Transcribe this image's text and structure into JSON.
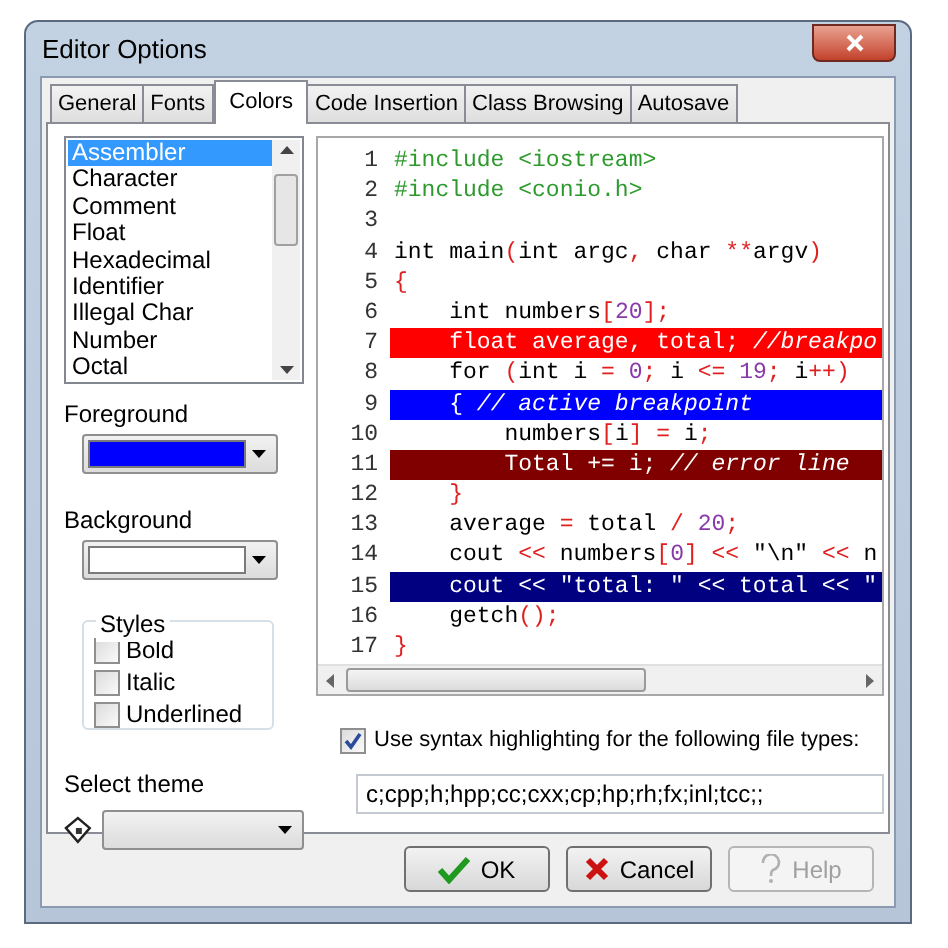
{
  "window": {
    "title": "Editor Options"
  },
  "tabs": [
    {
      "label": "General",
      "selected": false
    },
    {
      "label": "Fonts",
      "selected": false
    },
    {
      "label": "Colors",
      "selected": true
    },
    {
      "label": "Code Insertion",
      "selected": false
    },
    {
      "label": "Class Browsing",
      "selected": false
    },
    {
      "label": "Autosave",
      "selected": false
    }
  ],
  "element_list": [
    {
      "label": "Assembler",
      "selected": true
    },
    {
      "label": "Character",
      "selected": false
    },
    {
      "label": "Comment",
      "selected": false
    },
    {
      "label": "Float",
      "selected": false
    },
    {
      "label": "Hexadecimal",
      "selected": false
    },
    {
      "label": "Identifier",
      "selected": false
    },
    {
      "label": "Illegal Char",
      "selected": false
    },
    {
      "label": "Number",
      "selected": false
    },
    {
      "label": "Octal",
      "selected": false
    }
  ],
  "foreground": {
    "label": "Foreground",
    "color": "#0000ff"
  },
  "background": {
    "label": "Background",
    "color": "#ffffff"
  },
  "styles": {
    "title": "Styles",
    "options": [
      {
        "label": "Bold",
        "checked": false
      },
      {
        "label": "Italic",
        "checked": false
      },
      {
        "label": "Underlined",
        "checked": false
      }
    ]
  },
  "theme": {
    "label": "Select theme"
  },
  "code_lines": [
    {
      "number": "1",
      "kind": "normal",
      "tokens": [
        {
          "kind": "pre",
          "text": "#include <iostream>"
        }
      ]
    },
    {
      "number": "2",
      "kind": "normal",
      "tokens": [
        {
          "kind": "pre",
          "text": "#include <conio.h>"
        }
      ]
    },
    {
      "number": "3",
      "kind": "normal"
    },
    {
      "number": "4",
      "kind": "normal",
      "tokens": [
        {
          "kind": "plain",
          "text": "int main"
        },
        {
          "kind": "sym",
          "text": "("
        },
        {
          "kind": "plain",
          "text": "int argc"
        },
        {
          "kind": "sym",
          "text": ","
        },
        {
          "kind": "plain",
          "text": " char "
        },
        {
          "kind": "sym",
          "text": "**"
        },
        {
          "kind": "plain",
          "text": "argv"
        },
        {
          "kind": "sym",
          "text": ")"
        }
      ]
    },
    {
      "number": "5",
      "kind": "normal",
      "tokens": [
        {
          "kind": "sym",
          "text": "{"
        }
      ]
    },
    {
      "number": "6",
      "kind": "normal",
      "tokens": [
        {
          "kind": "plain",
          "text": "    int numbers"
        },
        {
          "kind": "sym",
          "text": "["
        },
        {
          "kind": "num",
          "text": "20"
        },
        {
          "kind": "sym",
          "text": "];"
        }
      ]
    },
    {
      "number": "7",
      "kind": "breakpoint",
      "tokens": [
        {
          "kind": "plain",
          "text": "    float average, total; "
        },
        {
          "kind": "comment",
          "text": "//breakpo"
        }
      ]
    },
    {
      "number": "8",
      "kind": "normal",
      "tokens": [
        {
          "kind": "plain",
          "text": "    for "
        },
        {
          "kind": "sym",
          "text": "("
        },
        {
          "kind": "plain",
          "text": "int i "
        },
        {
          "kind": "sym",
          "text": "= "
        },
        {
          "kind": "num",
          "text": "0"
        },
        {
          "kind": "sym",
          "text": ";"
        },
        {
          "kind": "plain",
          "text": " i "
        },
        {
          "kind": "sym",
          "text": "<= "
        },
        {
          "kind": "num",
          "text": "19"
        },
        {
          "kind": "sym",
          "text": ";"
        },
        {
          "kind": "plain",
          "text": " i"
        },
        {
          "kind": "sym",
          "text": "++)"
        }
      ]
    },
    {
      "number": "9",
      "kind": "active",
      "tokens": [
        {
          "kind": "plain",
          "text": "    { "
        },
        {
          "kind": "comment",
          "text": "// active breakpoint"
        }
      ]
    },
    {
      "number": "10",
      "kind": "normal",
      "tokens": [
        {
          "kind": "plain",
          "text": "        numbers"
        },
        {
          "kind": "sym",
          "text": "["
        },
        {
          "kind": "plain",
          "text": "i"
        },
        {
          "kind": "sym",
          "text": "] ="
        },
        {
          "kind": "plain",
          "text": " i"
        },
        {
          "kind": "sym",
          "text": ";"
        }
      ]
    },
    {
      "number": "11",
      "kind": "error",
      "tokens": [
        {
          "kind": "plain",
          "text": "        Total += i; "
        },
        {
          "kind": "comment",
          "text": "// error line"
        }
      ]
    },
    {
      "number": "12",
      "kind": "normal",
      "tokens": [
        {
          "kind": "sym",
          "text": "    }"
        }
      ]
    },
    {
      "number": "13",
      "kind": "normal",
      "tokens": [
        {
          "kind": "plain",
          "text": "    average "
        },
        {
          "kind": "sym",
          "text": "="
        },
        {
          "kind": "plain",
          "text": " total "
        },
        {
          "kind": "sym",
          "text": "/ "
        },
        {
          "kind": "num",
          "text": "20"
        },
        {
          "kind": "sym",
          "text": ";"
        }
      ]
    },
    {
      "number": "14",
      "kind": "normal",
      "tokens": [
        {
          "kind": "plain",
          "text": "    cout "
        },
        {
          "kind": "sym",
          "text": "<<"
        },
        {
          "kind": "plain",
          "text": " numbers"
        },
        {
          "kind": "sym",
          "text": "["
        },
        {
          "kind": "num",
          "text": "0"
        },
        {
          "kind": "sym",
          "text": "] <<"
        },
        {
          "kind": "plain",
          "text": " \"\\n\" "
        },
        {
          "kind": "sym",
          "text": "<<"
        },
        {
          "kind": "plain",
          "text": " n"
        }
      ]
    },
    {
      "number": "15",
      "kind": "selection",
      "tokens": [
        {
          "kind": "plain",
          "text": "    cout << \"total: \" << total << \""
        }
      ]
    },
    {
      "number": "16",
      "kind": "normal",
      "tokens": [
        {
          "kind": "plain",
          "text": "    getch"
        },
        {
          "kind": "sym",
          "text": "();"
        }
      ]
    },
    {
      "number": "17",
      "kind": "normal",
      "tokens": [
        {
          "kind": "sym",
          "text": "}"
        }
      ]
    }
  ],
  "syntax_highlighting": {
    "label": "Use syntax highlighting for the following file types:",
    "checked": true,
    "value": "c;cpp;h;hpp;cc;cxx;cp;hp;rh;fx;inl;tcc;;"
  },
  "buttons": [
    {
      "kind": "ok",
      "label": "OK",
      "disabled": false
    },
    {
      "kind": "cancel",
      "label": "Cancel",
      "disabled": false
    },
    {
      "kind": "help",
      "label": "Help",
      "disabled": true
    }
  ]
}
